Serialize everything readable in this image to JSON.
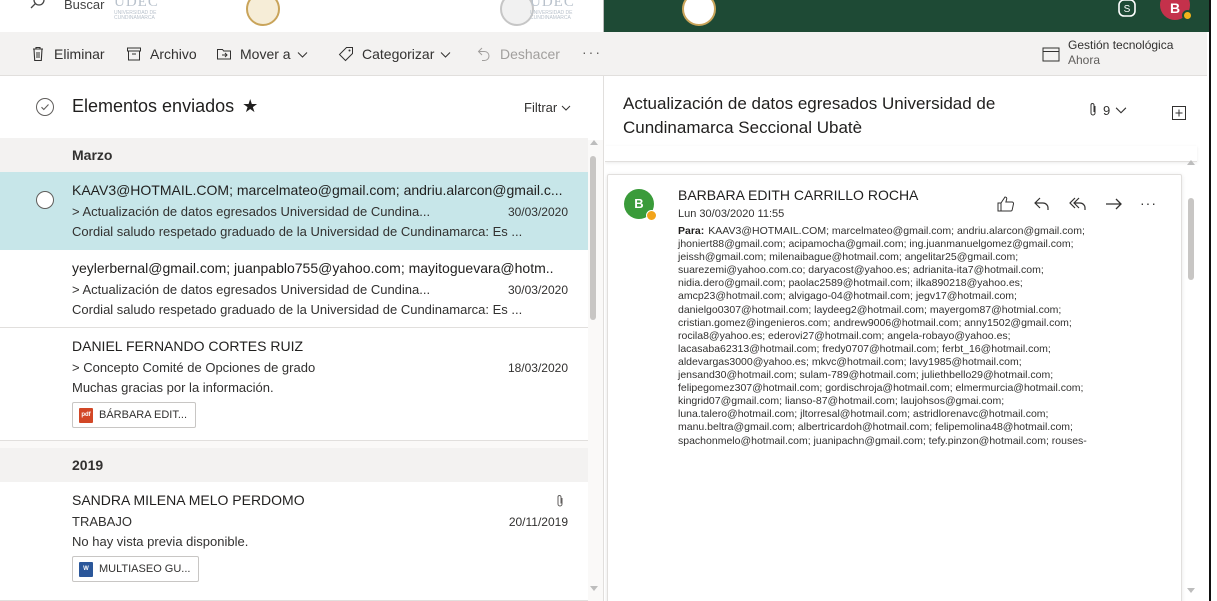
{
  "topbar": {
    "search_placeholder": "Buscar",
    "logo_text": "UDEC",
    "logo_sub": "UNIVERSIDAD DE CUNDINAMARCA",
    "avatar_initial": "B"
  },
  "toolbar": {
    "delete": "Eliminar",
    "archive": "Archivo",
    "move": "Mover a",
    "categorize": "Categorizar",
    "undo": "Deshacer",
    "reminder_title": "Gestión tecnológica",
    "reminder_time": "Ahora"
  },
  "list": {
    "folder": "Elementos enviados",
    "filter": "Filtrar",
    "groups": [
      "Marzo",
      "2019"
    ],
    "items": [
      {
        "from": "KAAV3@HOTMAIL.COM; marcelmateo@gmail.com; andriu.alarcon@gmail.c...",
        "subject": "> Actualización de datos egresados Universidad de Cundina...",
        "date": "30/03/2020",
        "preview": "Cordial saludo respetado graduado de la Universidad de Cundinamarca: Es ..."
      },
      {
        "from": "yeylerbernal@gmail.com; juanpablo755@yahoo.com; mayitoguevara@hotm..",
        "subject": "> Actualización de datos egresados Universidad de Cundina...",
        "date": "30/03/2020",
        "preview": "Cordial saludo respetado graduado de la Universidad de Cundinamarca: Es ..."
      },
      {
        "from": "DANIEL FERNANDO CORTES RUIZ",
        "subject": "> Concepto Comité de Opciones de grado",
        "date": "18/03/2020",
        "preview": "Muchas gracias por la información.",
        "attachment": "BÁRBARA EDIT..."
      },
      {
        "from": "SANDRA MILENA MELO PERDOMO",
        "subject": "TRABAJO",
        "date": "20/11/2019",
        "preview": "No hay vista previa disponible.",
        "attachment": "MULTIASEO GU..."
      }
    ]
  },
  "reading": {
    "title": "Actualización de datos egresados Universidad de Cundinamarca Seccional Ubatè",
    "attachment_count": "9",
    "avatar_initial": "B",
    "sender": "BARBARA EDITH CARRILLO ROCHA",
    "date": "Lun 30/03/2020 11:55",
    "to_label": "Para:",
    "recipients": "KAAV3@HOTMAIL.COM; marcelmateo@gmail.com; andriu.alarcon@gmail.com; jhoniert88@gmail.com; acipamocha@gmail.com; ing.juanmanuelgomez@gmail.com; jeissh@gmail.com; milenaibague@hotmail.com; angelitar25@gmail.com; suarezemi@yahoo.com.co; daryacost@yahoo.es; adrianita-ita7@hotmail.com; nidia.dero@gmail.com; paolac2589@hotmail.com; ilka890218@yahoo.es; amcp23@hotmail.com; alvigago-04@hotmail.com; jegv17@hotmail.com; danielgo0307@hotmail.com; laydeeg2@hotmail.com; mayergom87@hotmial.com; cristian.gomez@ingenieros.com; andrew9006@hotmail.com; anny1502@gmail.com; rocila8@yahoo.es; ederovi27@hotmail.com; angela-robayo@yahoo.es; lacasaba62313@hotmail.com; fredy0707@hotmail.com; ferbt_16@hotmail.com; aldevargas3000@yahoo.es; mkvc@hotmail.com; lavy1985@hotmail.com; jensand30@hotmail.com; sulam-789@hotmail.com; juliethbello29@hotmail.com; felipegomez307@hotmail.com; gordischroja@hotmail.com; elmermurcia@hotmail.com; kingrid07@gmail.com; lianso-87@hotmail.com; laujohsos@gmai.com; luna.talero@hotmail.com; jltorresal@hotmail.com; astridlorenavc@hotmail.com; manu.beltra@gmail.com; albertricardoh@hotmail.com; felipemolina48@hotmail.com; spachonmelo@hotmail.com; juanipachn@gmail.com; tefy.pinzon@hotmail.com; rouses-"
  },
  "colors": {
    "topbar": "#1e4a35",
    "selected": "#c7e6e9",
    "avatar_green": "#3a9b3a",
    "avatar_red": "#c4314b",
    "presence": "#f2a41b"
  }
}
